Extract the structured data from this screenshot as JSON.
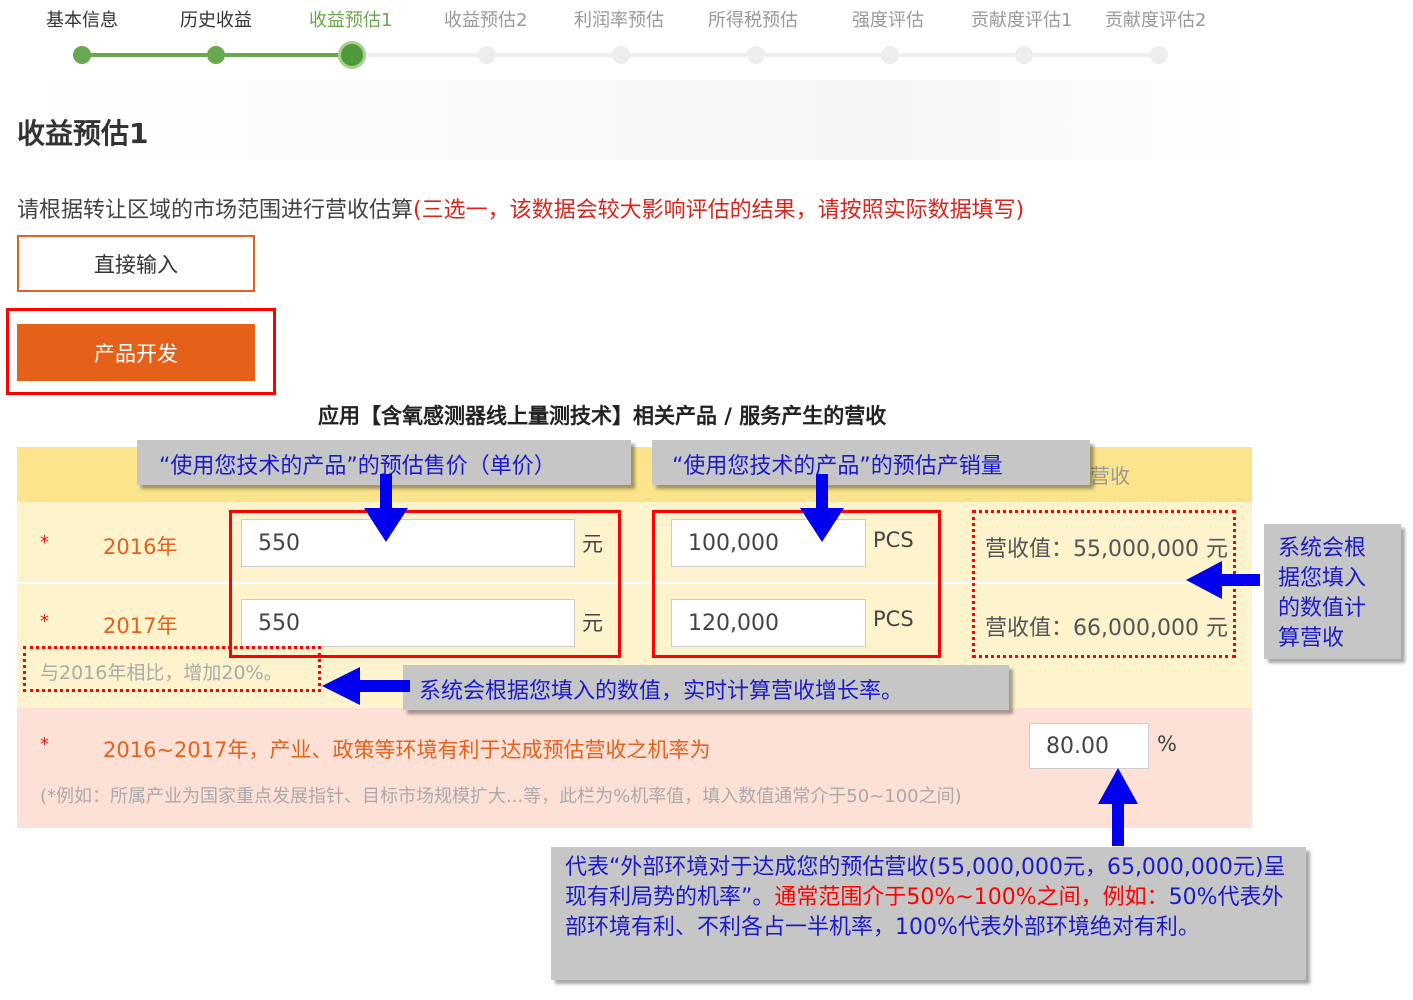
{
  "stepper": {
    "steps": [
      "基本信息",
      "历史收益",
      "收益预估1",
      "收益预估2",
      "利润率预估",
      "所得税预估",
      "强度评估",
      "贡献度评估1",
      "贡献度评估2"
    ],
    "active_index": 2
  },
  "page": {
    "title": "收益预估1",
    "description": "请根据转让区域的市场范围进行营收估算",
    "description_warning": "(三选一，该数据会较大影响评估的结果，请按照实际数据填写)"
  },
  "options": {
    "direct_input_label": "直接输入",
    "product_dev_label": "产品开发"
  },
  "section_title": "应用【含氧感测器线上量测技术】相关产品 / 服务产生的营收",
  "table": {
    "header_partial": "营收",
    "rows": [
      {
        "star": "*",
        "year": "2016年",
        "price": "550",
        "price_unit": "元",
        "volume": "100,000",
        "volume_unit": "PCS",
        "revenue": "营收值：55,000,000 元"
      },
      {
        "star": "*",
        "year": "2017年",
        "price": "550",
        "price_unit": "元",
        "volume": "120,000",
        "volume_unit": "PCS",
        "revenue": "营收值：66,000,000 元"
      }
    ],
    "growth_text": "与2016年相比，增加20%。",
    "probability": {
      "star": "*",
      "label": "2016~2017年，产业、政策等环境有利于达成预估营收之机率为",
      "value": "80.00",
      "unit": "%",
      "hint": "(*例如：所属产业为国家重点发展指针、目标市场规模扩大...等，此栏为%机率值，填入数值通常介于50~100之间)"
    }
  },
  "annotations": {
    "price_callout": "“使用您技术的产品”的预估售价（单价）",
    "volume_callout": "“使用您技术的产品”的预估产销量",
    "revenue_callout_lines": [
      "系统会根",
      "据您填入",
      "的数值计",
      "算营收"
    ],
    "growth_callout": "系统会根据您填入的数值，实时计算营收增长率。",
    "probability_callout_part1": "代表“外部环境对于达成您的预估营收(55,000,000元，65,000,000元)呈现有利局势的机率”。",
    "probability_callout_part2": "通常范围介于50%~100%之间，例如：",
    "probability_callout_part3": "50%代表外部环境有利、不利各占一半机率，100%代表外部环境绝对有利。"
  },
  "colors": {
    "accent_orange": "#e5611a",
    "progress_green": "#6aa84f",
    "annotation_red": "#ff0000",
    "annotation_blue": "#0000ee"
  }
}
